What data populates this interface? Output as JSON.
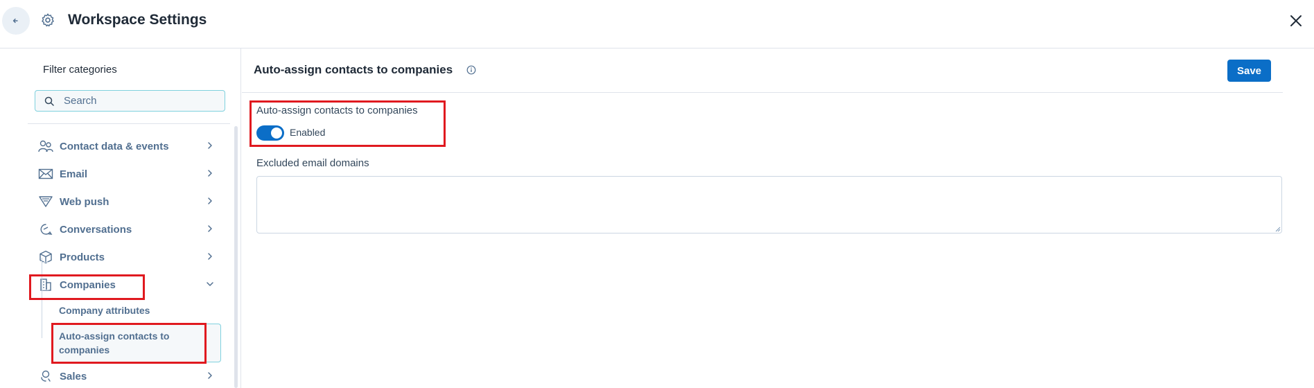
{
  "header": {
    "title": "Workspace Settings",
    "back_icon": "arrow-left-icon",
    "settings_icon": "gear-icon",
    "close_icon": "close-icon"
  },
  "sidebar": {
    "filter_title": "Filter categories",
    "search": {
      "placeholder": "Search",
      "value": ""
    },
    "items": [
      {
        "label": "Contact data & events",
        "icon": "contacts-icon",
        "expanded": false
      },
      {
        "label": "Email",
        "icon": "envelope-icon",
        "expanded": false
      },
      {
        "label": "Web push",
        "icon": "web-push-icon",
        "expanded": false
      },
      {
        "label": "Conversations",
        "icon": "chat-icon",
        "expanded": false
      },
      {
        "label": "Products",
        "icon": "box-icon",
        "expanded": false
      },
      {
        "label": "Companies",
        "icon": "building-icon",
        "expanded": true
      },
      {
        "label": "Sales",
        "icon": "sales-icon",
        "expanded": false
      }
    ],
    "companies_sub": [
      {
        "label": "Company attributes",
        "active": false
      },
      {
        "label": "Auto-assign contacts to companies",
        "active": true
      }
    ]
  },
  "main": {
    "title": "Auto-assign contacts to companies",
    "info_icon": "info-icon",
    "save_label": "Save",
    "auto_assign_label": "Auto-assign contacts to companies",
    "toggle": {
      "label": "Enabled",
      "on": true
    },
    "excluded_label": "Excluded email domains",
    "excluded_value": ""
  },
  "colors": {
    "accent": "#0b6ec7",
    "highlight": "#e0191f",
    "focus_border": "#7fd1de",
    "text_muted": "#516f90"
  }
}
